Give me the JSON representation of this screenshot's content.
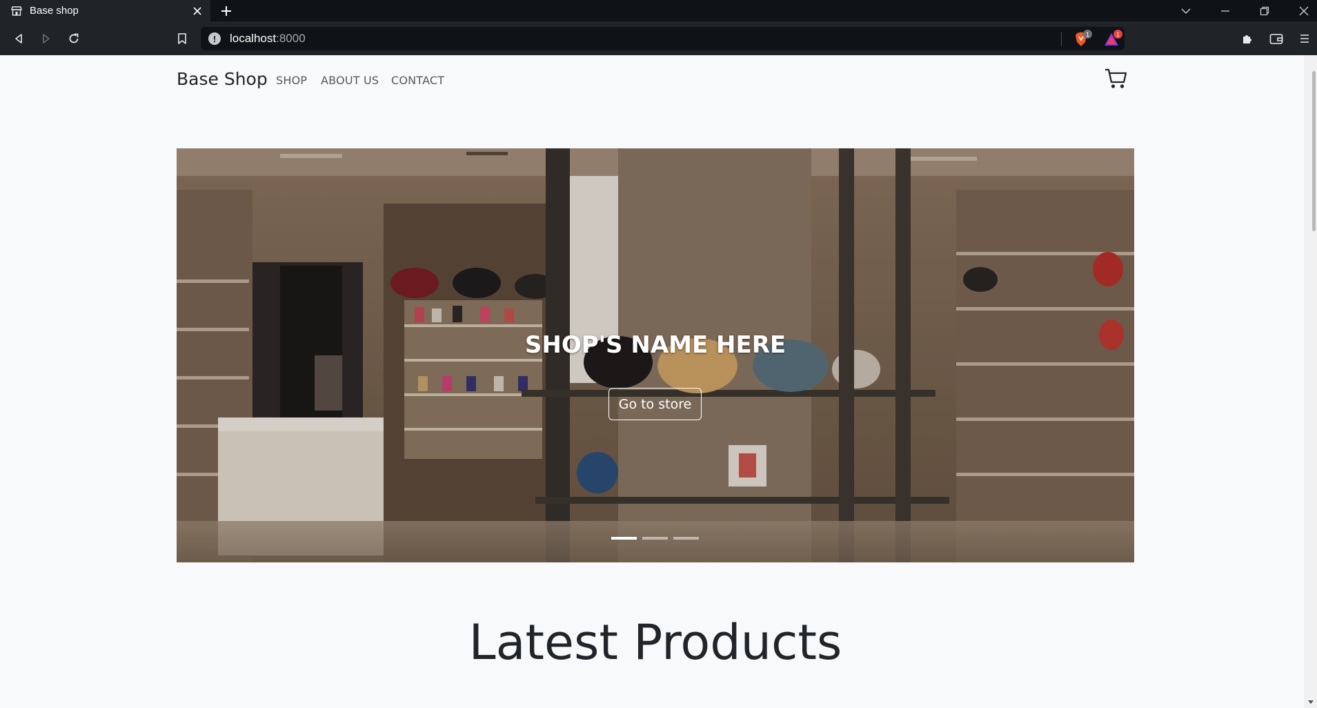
{
  "browser": {
    "tab": {
      "title": "Base shop"
    },
    "address": {
      "host": "localhost",
      "port": ":8000"
    },
    "extensions": {
      "brave_shields_badge": "1",
      "brave_rewards_badge": "1"
    }
  },
  "site": {
    "brand": "Base Shop",
    "nav": [
      {
        "label": "SHOP"
      },
      {
        "label": "ABOUT US"
      },
      {
        "label": "CONTACT"
      }
    ],
    "hero": {
      "title": "SHOP'S NAME HERE",
      "button_label": "Go to store",
      "slides_total": 3,
      "active_slide": 1
    },
    "section_title": "Latest Products"
  },
  "colors": {
    "tabstrip_bg": "#0f1216",
    "toolbar_bg": "#202429",
    "page_bg": "#f8f9fa",
    "text_dark": "#212529",
    "nav_muted": "#55595c"
  }
}
